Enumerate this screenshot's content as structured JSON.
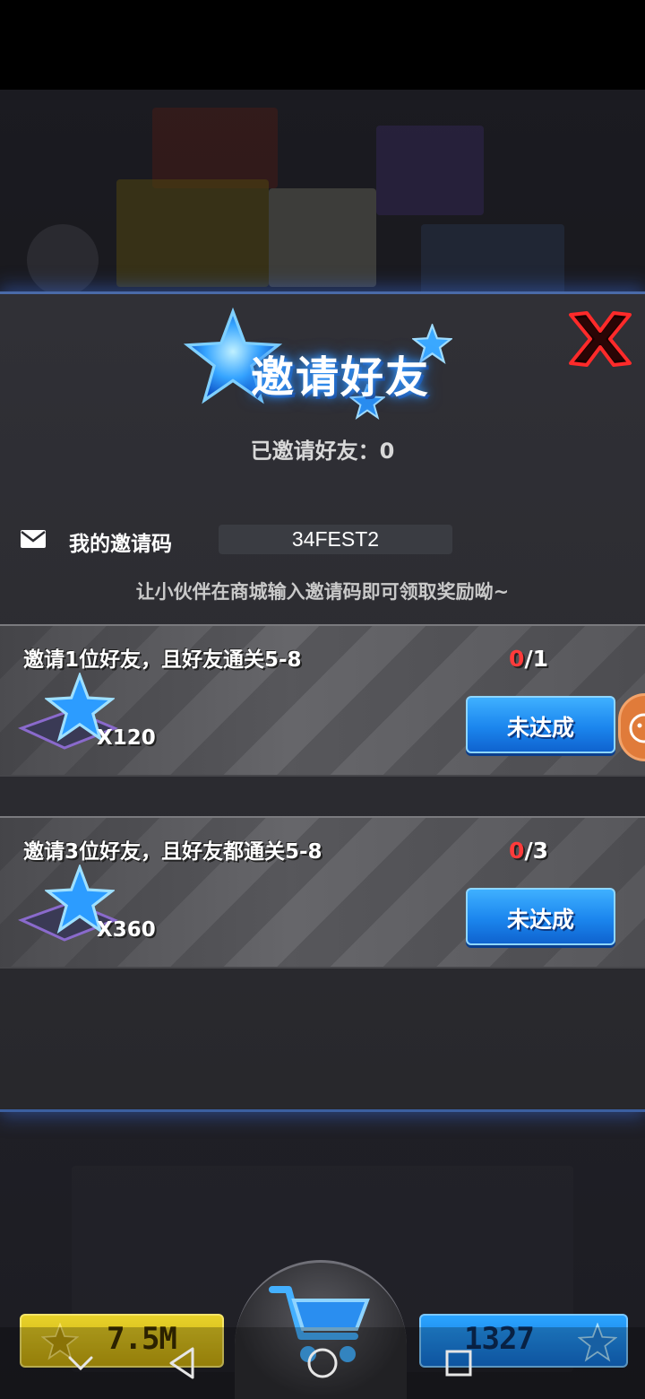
{
  "popup": {
    "title": "邀请好友",
    "invited_count": "已邀请好友：0",
    "code_label": "我的邀请码",
    "code_value": "34FEST2",
    "hint": "让小伙伴在商城输入邀请码即可领取奖励呦~"
  },
  "tasks": [
    {
      "title": "邀请1位好友，且好友通关5-8",
      "progress_done": "0",
      "progress_total": "/1",
      "reward_qty": "X120",
      "button_label": "未达成"
    },
    {
      "title": "邀请3位好友，且好友都通关5-8",
      "progress_done": "0",
      "progress_total": "/3",
      "reward_qty": "X360",
      "button_label": "未达成"
    }
  ],
  "bottom_bar": {
    "coins": "7.5M",
    "gems": "1327"
  },
  "icons": {
    "close": "close-x-icon",
    "mail": "mail-icon",
    "reward": "blue-star-icon",
    "shop": "shopping-cart-icon"
  },
  "colors": {
    "accent_blue": "#1b86ee",
    "progress_red": "#ff3b3b",
    "coin_yellow": "#e8d22a"
  }
}
